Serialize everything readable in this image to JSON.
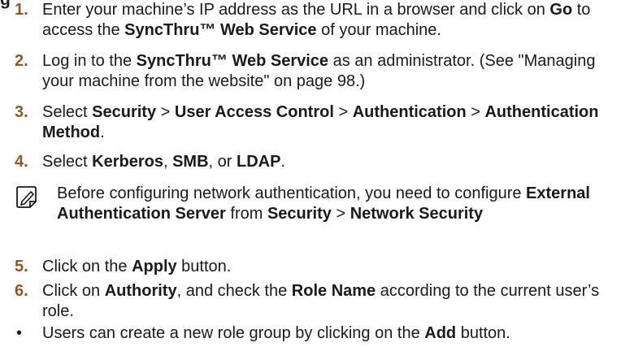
{
  "heading_fragment": "g",
  "steps": [
    {
      "num": "1.",
      "parts": [
        {
          "t": "Enter your machine’s IP address as the URL in a browser and click on "
        },
        {
          "t": "Go",
          "b": true
        },
        {
          "t": " to access the "
        },
        {
          "t": "SyncThru™ Web Service",
          "b": true
        },
        {
          "t": " of your machine."
        }
      ]
    },
    {
      "num": "2.",
      "parts": [
        {
          "t": "Log in to the "
        },
        {
          "t": "SyncThru™ Web Service",
          "b": true
        },
        {
          "t": " as an administrator. (See \"Managing your machine from the website\" on page 98.)"
        }
      ]
    },
    {
      "num": "3.",
      "parts": [
        {
          "t": "Select "
        },
        {
          "t": "Security",
          "b": true
        },
        {
          "t": " > "
        },
        {
          "t": "User Access Control",
          "b": true
        },
        {
          "t": " > "
        },
        {
          "t": "Authentication",
          "b": true
        },
        {
          "t": " > "
        },
        {
          "t": "Authentication Method",
          "b": true
        },
        {
          "t": "."
        }
      ]
    },
    {
      "num": "4.",
      "parts": [
        {
          "t": "Select "
        },
        {
          "t": "Kerberos",
          "b": true
        },
        {
          "t": ", "
        },
        {
          "t": "SMB",
          "b": true
        },
        {
          "t": ", or "
        },
        {
          "t": "LDAP",
          "b": true
        },
        {
          "t": "."
        }
      ]
    },
    {
      "num": "5.",
      "parts": [
        {
          "t": "Click on the "
        },
        {
          "t": "Apply",
          "b": true
        },
        {
          "t": " button."
        }
      ]
    },
    {
      "num": "6.",
      "parts": [
        {
          "t": "Click on "
        },
        {
          "t": "Authority",
          "b": true
        },
        {
          "t": ", and check the "
        },
        {
          "t": "Role Name",
          "b": true
        },
        {
          "t": " according to the current user’s role."
        }
      ]
    }
  ],
  "note": {
    "icon": "note-pencil-icon",
    "parts": [
      {
        "t": "Before configuring network authentication, you need to configure "
      },
      {
        "t": "External Authentication Server",
        "b": true
      },
      {
        "t": " from "
      },
      {
        "t": "Security",
        "b": true
      },
      {
        "t": " > "
      },
      {
        "t": "Network Security",
        "b": true
      }
    ]
  },
  "bullet": {
    "symbol": "•",
    "parts": [
      {
        "t": "Users can create a new role group by clicking on the "
      },
      {
        "t": "Add",
        "b": true
      },
      {
        "t": " button."
      }
    ]
  }
}
